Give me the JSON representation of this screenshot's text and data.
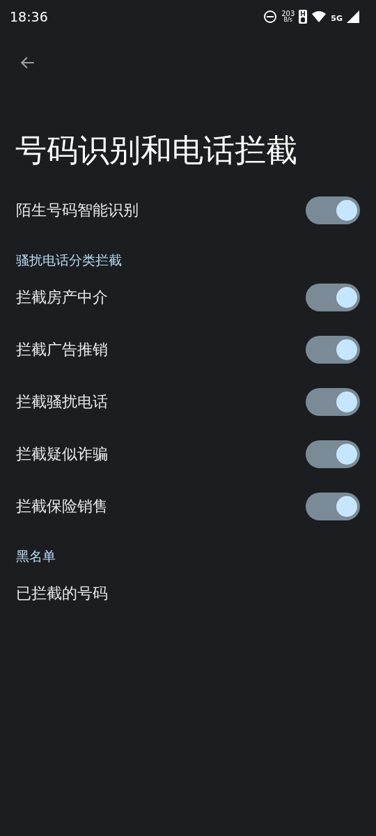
{
  "status_bar": {
    "time": "18:36",
    "speed": "203",
    "speed_unit": "B/s",
    "network": "5G"
  },
  "title": "号码识别和电话拦截",
  "sections": [
    {
      "items": [
        {
          "kind": "switch",
          "label": "陌生号码智能识别",
          "on": true
        }
      ]
    },
    {
      "header": "骚扰电话分类拦截",
      "items": [
        {
          "kind": "switch",
          "label": "拦截房产中介",
          "on": true
        },
        {
          "kind": "switch",
          "label": "拦截广告推销",
          "on": true
        },
        {
          "kind": "switch",
          "label": "拦截骚扰电话",
          "on": true
        },
        {
          "kind": "switch",
          "label": "拦截疑似诈骗",
          "on": true
        },
        {
          "kind": "switch",
          "label": "拦截保险销售",
          "on": true
        }
      ]
    },
    {
      "header": "黑名单",
      "items": [
        {
          "kind": "link",
          "label": "已拦截的号码"
        }
      ]
    }
  ]
}
